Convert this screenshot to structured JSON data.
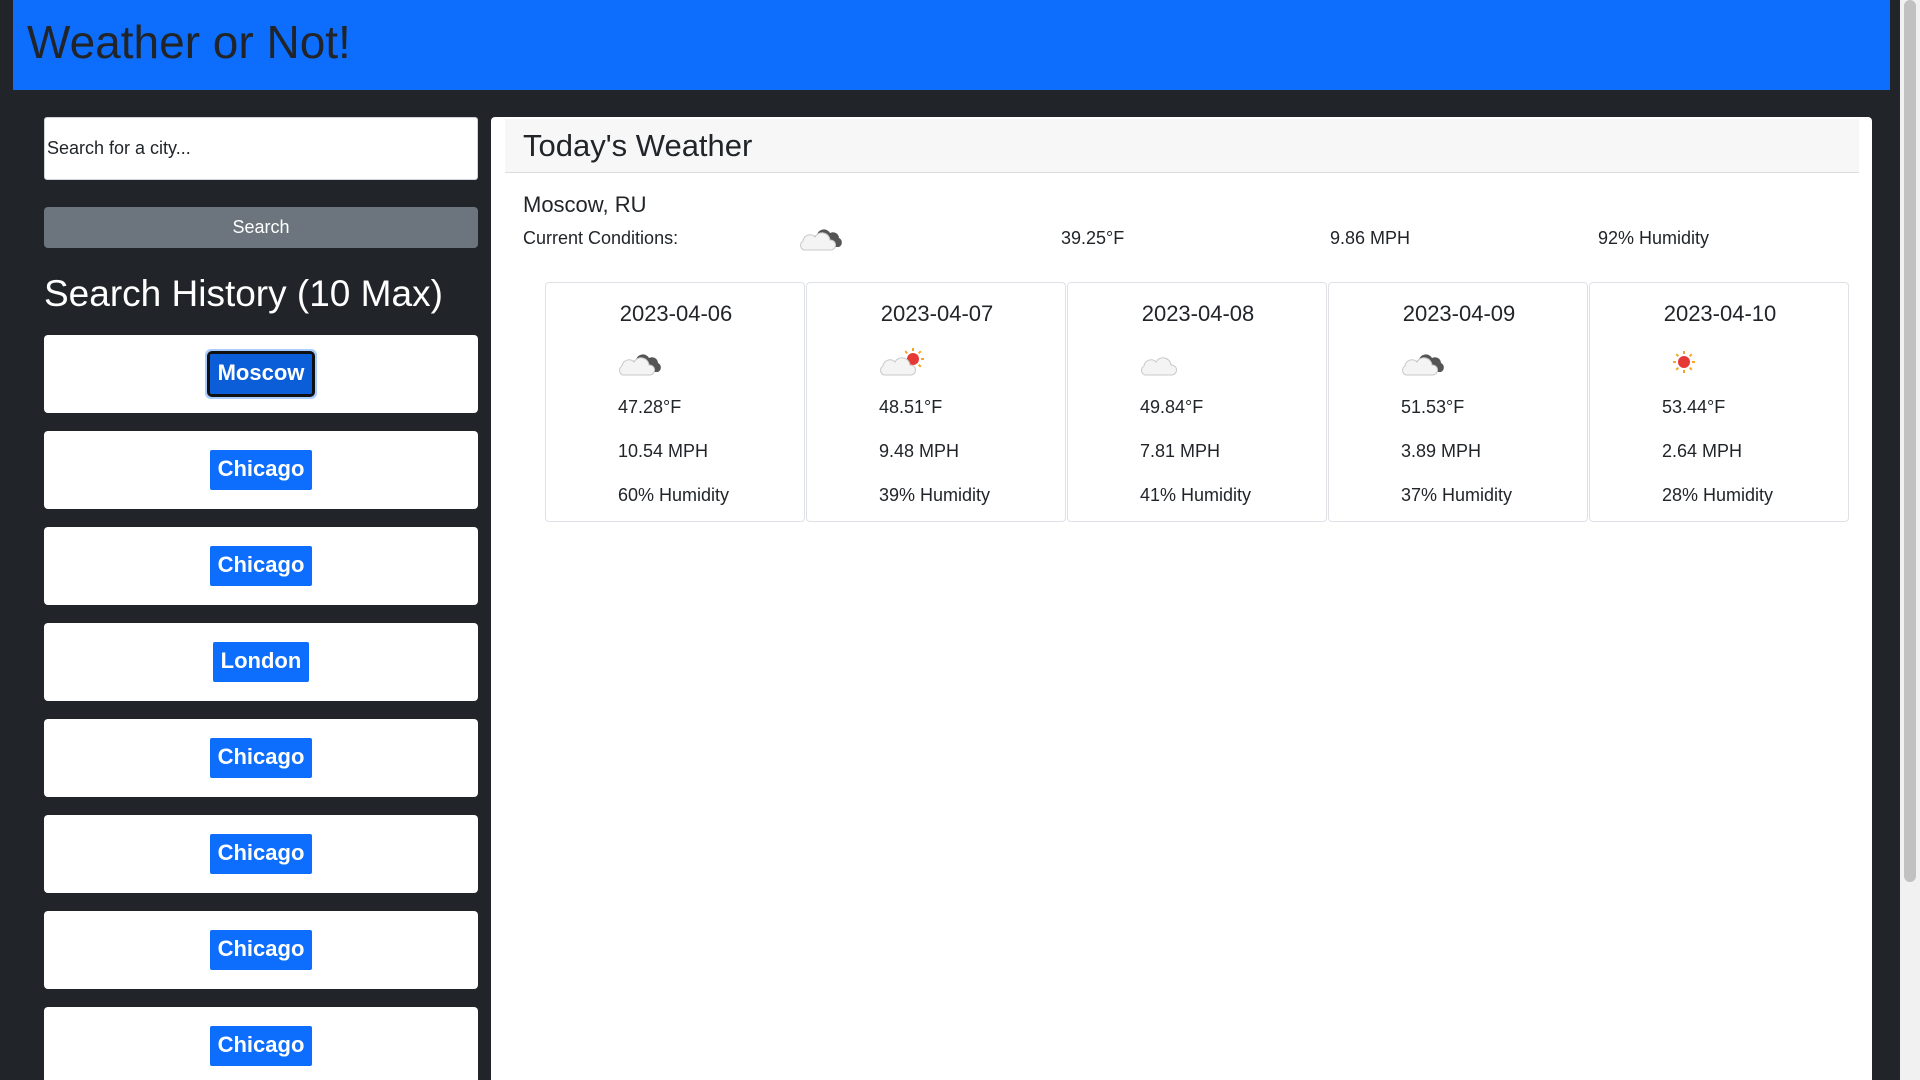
{
  "header": {
    "title": "Weather or Not!"
  },
  "search": {
    "placeholder": "Search for a city...",
    "button_label": "Search"
  },
  "history": {
    "title": "Search History (10 Max)",
    "items": [
      {
        "label": "Moscow",
        "active": true
      },
      {
        "label": "Chicago"
      },
      {
        "label": "Chicago"
      },
      {
        "label": "London"
      },
      {
        "label": "Chicago"
      },
      {
        "label": "Chicago"
      },
      {
        "label": "Chicago"
      },
      {
        "label": "Chicago"
      }
    ]
  },
  "today": {
    "title": "Today's Weather",
    "city": "Moscow, RU",
    "label": "Current Conditions:",
    "icon": "broken-clouds-icon",
    "temp": "39.25°F",
    "wind": "9.86 MPH",
    "humidity": "92% Humidity"
  },
  "forecast": [
    {
      "date": "2023-04-06",
      "icon": "broken-clouds-icon",
      "temp": "47.28°F",
      "wind": "10.54 MPH",
      "humidity": "60% Humidity"
    },
    {
      "date": "2023-04-07",
      "icon": "few-clouds-icon",
      "temp": "48.51°F",
      "wind": "9.48 MPH",
      "humidity": "39% Humidity"
    },
    {
      "date": "2023-04-08",
      "icon": "scattered-clouds-icon",
      "temp": "49.84°F",
      "wind": "7.81 MPH",
      "humidity": "41% Humidity"
    },
    {
      "date": "2023-04-09",
      "icon": "broken-clouds-icon",
      "temp": "51.53°F",
      "wind": "3.89 MPH",
      "humidity": "37% Humidity"
    },
    {
      "date": "2023-04-10",
      "icon": "clear-sky-icon",
      "temp": "53.44°F",
      "wind": "2.64 MPH",
      "humidity": "28% Humidity"
    }
  ],
  "colors": {
    "primary": "#0d6efd",
    "dark": "#212529",
    "secondary": "#6c757d"
  }
}
